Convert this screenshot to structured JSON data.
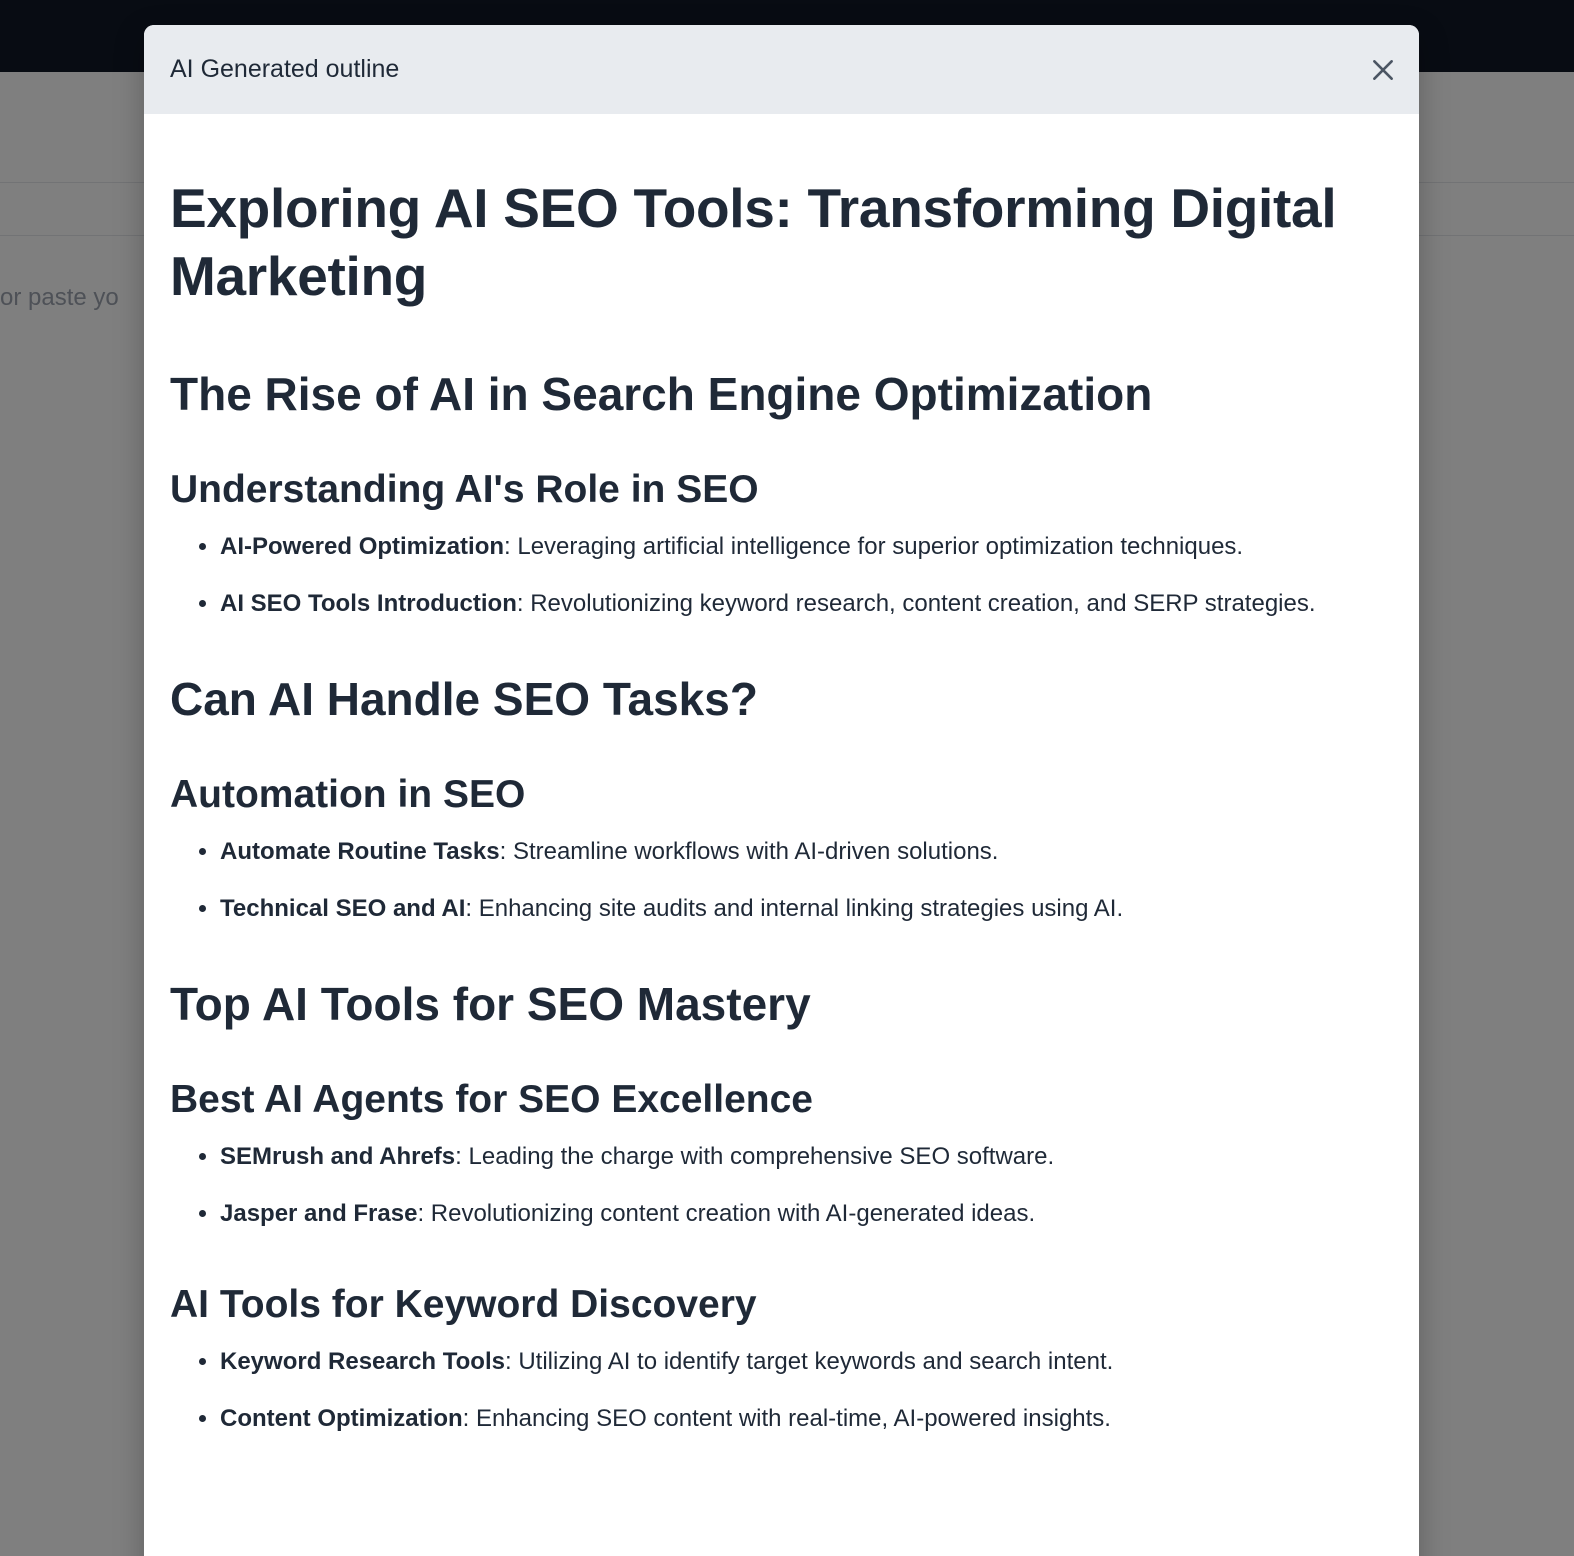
{
  "background": {
    "editor_placeholder": "ft or paste yo"
  },
  "modal": {
    "title": "AI Generated outline",
    "close_icon": "close-icon",
    "doc_title": "Exploring AI SEO Tools: Transforming Digital Marketing",
    "sections": [
      {
        "heading": "The Rise of AI in Search Engine Optimization",
        "subsections": [
          {
            "heading": "Understanding AI's Role in SEO",
            "points": [
              {
                "bold": "AI-Powered Optimization",
                "text": ": Leveraging artificial intelligence for superior optimization techniques."
              },
              {
                "bold": "AI SEO Tools Introduction",
                "text": ": Revolutionizing keyword research, content creation, and SERP strategies."
              }
            ]
          }
        ]
      },
      {
        "heading": "Can AI Handle SEO Tasks?",
        "subsections": [
          {
            "heading": "Automation in SEO",
            "points": [
              {
                "bold": "Automate Routine Tasks",
                "text": ": Streamline workflows with AI-driven solutions."
              },
              {
                "bold": "Technical SEO and AI",
                "text": ": Enhancing site audits and internal linking strategies using AI."
              }
            ]
          }
        ]
      },
      {
        "heading": "Top AI Tools for SEO Mastery",
        "subsections": [
          {
            "heading": "Best AI Agents for SEO Excellence",
            "points": [
              {
                "bold": "SEMrush and Ahrefs",
                "text": ": Leading the charge with comprehensive SEO software."
              },
              {
                "bold": "Jasper and Frase",
                "text": ": Revolutionizing content creation with AI-generated ideas."
              }
            ]
          },
          {
            "heading": "AI Tools for Keyword Discovery",
            "points": [
              {
                "bold": "Keyword Research Tools",
                "text": ": Utilizing AI to identify target keywords and search intent."
              },
              {
                "bold": "Content Optimization",
                "text": ": Enhancing SEO content with real-time, AI-powered insights."
              }
            ]
          }
        ]
      }
    ]
  },
  "colors": {
    "topbar": "#111827",
    "modal_header": "#e8ebef",
    "text": "#1f2937",
    "close_icon": "#4b5563"
  }
}
